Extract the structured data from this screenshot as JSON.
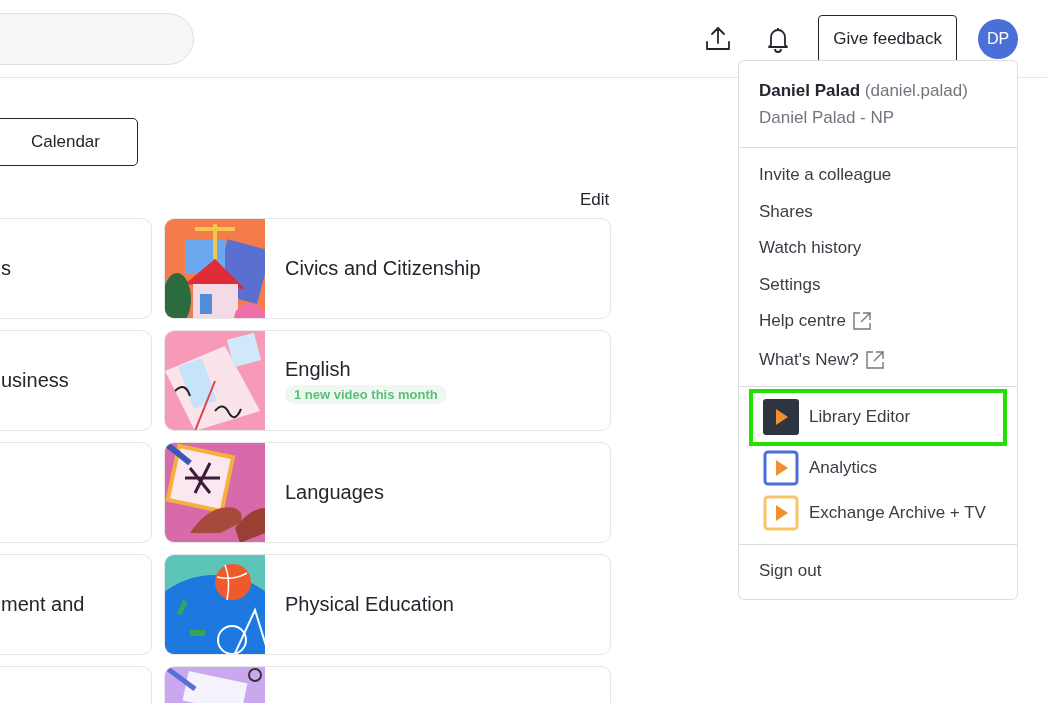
{
  "header": {
    "feedback_button": "Give feedback",
    "avatar": "DP"
  },
  "calendar_button": "Calendar",
  "edit_link": "Edit",
  "cards_left": [
    {
      "kind": "titled",
      "title": "s"
    },
    {
      "kind": "titled",
      "title": "usiness"
    },
    {
      "kind": "blank"
    },
    {
      "kind": "titled",
      "title": "ment and"
    },
    {
      "kind": "blank"
    }
  ],
  "cards": [
    {
      "title": "Civics and Citizenship",
      "picture": {
        "kind": "picture"
      }
    },
    {
      "title": "English",
      "badge": "1 new video this month",
      "picture": {
        "kind": "picture"
      }
    },
    {
      "title": "Languages",
      "picture": {
        "kind": "picture"
      }
    },
    {
      "title": "Physical Education",
      "picture": {
        "kind": "picture"
      }
    },
    {
      "picture": {
        "kind": "picture"
      }
    }
  ],
  "user_menu": {
    "name": "Daniel Palad",
    "username": "(daniel.palad)",
    "organisation": "Daniel Palad - NP",
    "links": [
      {
        "label": "Invite a colleague",
        "external": false
      },
      {
        "label": "Shares",
        "external": false
      },
      {
        "label": "Watch history",
        "external": false
      },
      {
        "label": "Settings",
        "external": false
      },
      {
        "label": "Help centre",
        "external": true
      },
      {
        "label": "What's New?",
        "external": true
      }
    ],
    "apps": [
      {
        "label": "Library Editor",
        "kind": "filled",
        "color": "#2f3441",
        "selected": true
      },
      {
        "label": "Analytics",
        "kind": "outline",
        "color": "#4a6fd8",
        "selected": false
      },
      {
        "label": "Exchange Archive + TV",
        "kind": "outline",
        "color": "#f8c46a",
        "selected": false
      }
    ],
    "sign_out": "Sign out"
  }
}
